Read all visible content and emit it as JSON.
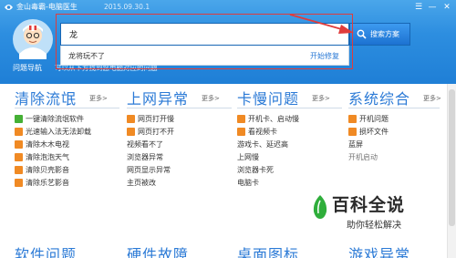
{
  "titlebar": {
    "app_name": "金山毒霸-电脑医生",
    "version": "2015.09.30.1",
    "window_buttons": {
      "menu": "☰",
      "minimize": "—",
      "close": "✕"
    }
  },
  "search": {
    "value": "龙",
    "button_label": "搜索方案",
    "suggestion": "龙将玩不了",
    "suggestion_action": "开始修复"
  },
  "nav": {
    "label": "问题导航",
    "hint": "可以从下方找到您电脑对应的问题"
  },
  "more_label": "更多>",
  "columns": [
    {
      "title": "清除流氓",
      "items": [
        {
          "text": "一键清除流氓软件",
          "icon": "green"
        },
        {
          "text": "光速输入法无法卸载",
          "icon": "orange"
        },
        {
          "text": "清除木木电视",
          "icon": "orange"
        },
        {
          "text": "清除泡泡天气",
          "icon": "orange"
        },
        {
          "text": "清除贝壳影音",
          "icon": "orange"
        },
        {
          "text": "清除乐艺影音",
          "icon": "orange"
        }
      ]
    },
    {
      "title": "上网异常",
      "items": [
        {
          "text": "网页打开慢",
          "icon": "orange"
        },
        {
          "text": "网页打不开",
          "icon": "orange"
        },
        {
          "text": "视频看不了",
          "icon": "none"
        },
        {
          "text": "浏览器异常",
          "icon": "none"
        },
        {
          "text": "网页显示异常",
          "icon": "none"
        },
        {
          "text": "主页被改",
          "icon": "none"
        }
      ]
    },
    {
      "title": "卡慢问题",
      "items": [
        {
          "text": "开机卡、启动慢",
          "icon": "orange"
        },
        {
          "text": "看视频卡",
          "icon": "orange"
        },
        {
          "text": "游戏卡、延迟高",
          "icon": "none"
        },
        {
          "text": "上网慢",
          "icon": "none"
        },
        {
          "text": "浏览器卡死",
          "icon": "none"
        },
        {
          "text": "电脑卡",
          "icon": "none"
        }
      ]
    },
    {
      "title": "系统综合",
      "items": [
        {
          "text": "开机问题",
          "icon": "orange"
        },
        {
          "text": "损坏文件",
          "icon": "orange"
        },
        {
          "text": "蓝屏",
          "icon": "none"
        },
        {
          "text": "开机启动",
          "icon": "none"
        }
      ]
    }
  ],
  "bottom_titles": [
    "软件问题",
    "硬件故障",
    "桌面图标",
    "游戏异常"
  ],
  "watermark": {
    "title": "百科全说",
    "subtitle": "助你轻松解决"
  },
  "colors": {
    "header_blue": "#2d8ee0",
    "title_blue": "#2b7ad6",
    "annotation_red": "#e03c3c",
    "icon_orange": "#f08a24",
    "icon_green": "#45b035"
  }
}
